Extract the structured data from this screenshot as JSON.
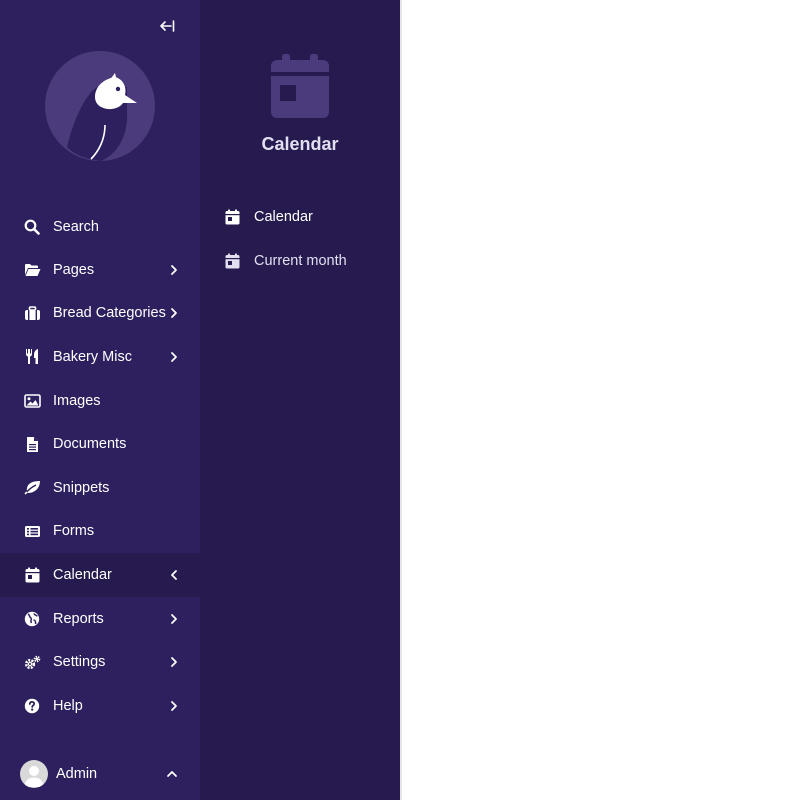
{
  "sidebar": {
    "search": {
      "label": "Search",
      "icon": "search-icon"
    },
    "items": [
      {
        "label": "Pages",
        "icon": "folder-open-icon",
        "has_submenu": true,
        "active": false
      },
      {
        "label": "Bread Categories",
        "icon": "suitcase-icon",
        "has_submenu": true,
        "active": false
      },
      {
        "label": "Bakery Misc",
        "icon": "utensils-icon",
        "has_submenu": true,
        "active": false
      },
      {
        "label": "Images",
        "icon": "image-icon",
        "has_submenu": false,
        "active": false
      },
      {
        "label": "Documents",
        "icon": "document-icon",
        "has_submenu": false,
        "active": false
      },
      {
        "label": "Snippets",
        "icon": "leaf-icon",
        "has_submenu": false,
        "active": false
      },
      {
        "label": "Forms",
        "icon": "list-icon",
        "has_submenu": false,
        "active": false
      },
      {
        "label": "Calendar",
        "icon": "calendar-icon",
        "has_submenu": true,
        "active": true
      },
      {
        "label": "Reports",
        "icon": "globe-icon",
        "has_submenu": true,
        "active": false
      },
      {
        "label": "Settings",
        "icon": "cogs-icon",
        "has_submenu": true,
        "active": false
      },
      {
        "label": "Help",
        "icon": "help-icon",
        "has_submenu": true,
        "active": false
      }
    ],
    "user": {
      "name": "Admin"
    }
  },
  "submenu": {
    "title": "Calendar",
    "items": [
      {
        "label": "Calendar",
        "icon": "calendar-icon"
      },
      {
        "label": "Current month",
        "icon": "calendar-icon"
      }
    ]
  },
  "colors": {
    "sidebar_bg": "#2e1f5e",
    "submenu_bg": "#261a4f",
    "text": "#ffffff",
    "muted": "#e2dff0"
  }
}
